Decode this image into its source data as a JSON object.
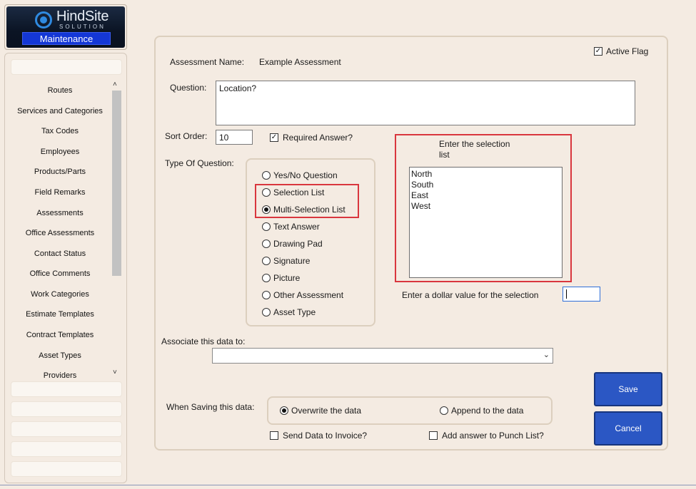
{
  "logo": {
    "brand_top": "HindSite",
    "brand_bottom": "SOLUTION",
    "module": "Maintenance"
  },
  "sidebar": {
    "items": [
      "Routes",
      "Services and Categories",
      "Tax Codes",
      "Employees",
      "Products/Parts",
      "Field Remarks",
      "Assessments",
      "Office Assessments",
      "Contact Status",
      "Office Comments",
      "Work Categories",
      "Estimate Templates",
      "Contract Templates",
      "Asset Types",
      "Providers"
    ],
    "scroll_up": "˄",
    "scroll_down": "˅"
  },
  "form": {
    "active_flag_label": "Active Flag",
    "active_flag_checked": true,
    "assessment_name_label": "Assessment Name:",
    "assessment_name_value": "Example Assessment",
    "question_label": "Question:",
    "question_value": "Location?",
    "sort_order_label": "Sort Order:",
    "sort_order_value": "10",
    "required_answer_label": "Required Answer?",
    "required_answer_checked": true,
    "type_label": "Type Of Question:",
    "question_types": [
      {
        "label": "Yes/No Question",
        "selected": false
      },
      {
        "label": "Selection List",
        "selected": false
      },
      {
        "label": "Multi-Selection List",
        "selected": true
      },
      {
        "label": "Text Answer",
        "selected": false
      },
      {
        "label": "Drawing Pad",
        "selected": false
      },
      {
        "label": "Signature",
        "selected": false
      },
      {
        "label": "Picture",
        "selected": false
      },
      {
        "label": "Other Assessment",
        "selected": false
      },
      {
        "label": "Asset Type",
        "selected": false
      }
    ],
    "selection_list_label_line1": "Enter the selection",
    "selection_list_label_line2": "list",
    "selection_list_values": [
      "North",
      "South",
      "East",
      "West"
    ],
    "dollar_label": "Enter a dollar value for the selection",
    "dollar_value": "",
    "associate_label": "Associate this data to:",
    "associate_value": "",
    "saving_label": "When Saving this data:",
    "save_modes": [
      {
        "label": "Overwrite the data",
        "selected": true
      },
      {
        "label": "Append to the data",
        "selected": false
      }
    ],
    "send_invoice_label": "Send Data to Invoice?",
    "send_invoice_checked": false,
    "punch_list_label": "Add answer to Punch List?",
    "punch_list_checked": false
  },
  "buttons": {
    "save": "Save",
    "cancel": "Cancel"
  },
  "colors": {
    "background": "#f4ebe2",
    "button_blue": "#2b57c4",
    "highlight_red": "#d9363e",
    "maintenance_badge": "#1437d6"
  },
  "icons": {
    "check": "✓",
    "chevron": "⌄"
  }
}
